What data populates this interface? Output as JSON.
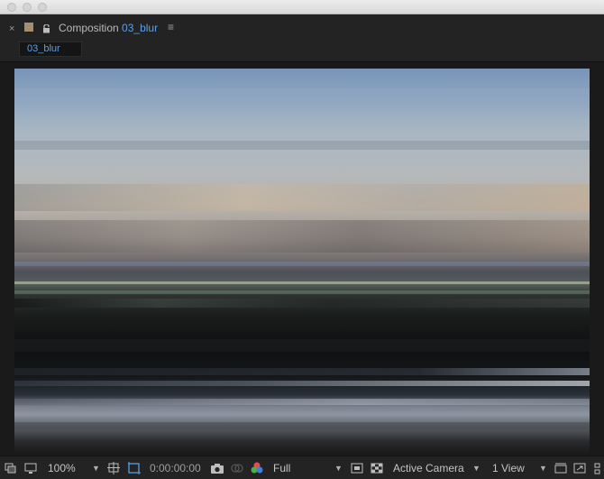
{
  "window": {
    "traffic_lights": [
      "close",
      "minimize",
      "zoom"
    ]
  },
  "panel": {
    "close_glyph": "×",
    "title_prefix": "Composition",
    "comp_name": "03_blur",
    "menu_glyph": "≡",
    "tab_label": "03_blur",
    "label_color": "#a48f6f",
    "accent_color": "#5aa0e6"
  },
  "toolbar": {
    "magnification": "100%",
    "timecode": "0:00:00:00",
    "resolution": "Full",
    "camera": "Active Camera",
    "views": "1 View"
  }
}
